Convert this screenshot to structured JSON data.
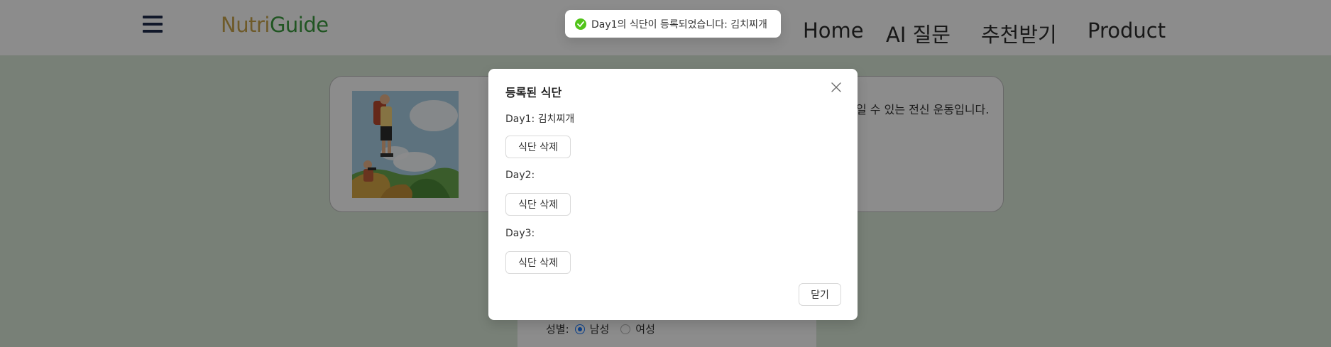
{
  "header": {
    "logo_part1": "Nutri",
    "logo_part2": "Guide",
    "nav": [
      "Home",
      "AI 질문",
      "추천받기",
      "Product"
    ]
  },
  "background": {
    "card_description": "일 수 있는 전신 운동입니다.",
    "gender": {
      "label": "성별:",
      "options": [
        "남성",
        "여성"
      ],
      "selected": "남성"
    }
  },
  "toast": {
    "message": "Day1의 식단이 등록되었습니다: 김치찌개",
    "status_color": "#52c41a"
  },
  "modal": {
    "title": "등록된 식단",
    "days": [
      {
        "label": "Day1: 김치찌개",
        "button": "식단 삭제"
      },
      {
        "label": "Day2:",
        "button": "식단 삭제"
      },
      {
        "label": "Day3:",
        "button": "식단 삭제"
      }
    ],
    "close_button": "닫기"
  },
  "colors": {
    "logo_nutri": "#c9a54b",
    "logo_guide": "#3b9c3e",
    "page_background": "#dbe9d9",
    "hamburger": "#1f2d4d"
  },
  "icons": [
    "menu-icon",
    "success-check-icon",
    "close-icon",
    "hiker-illustration"
  ]
}
